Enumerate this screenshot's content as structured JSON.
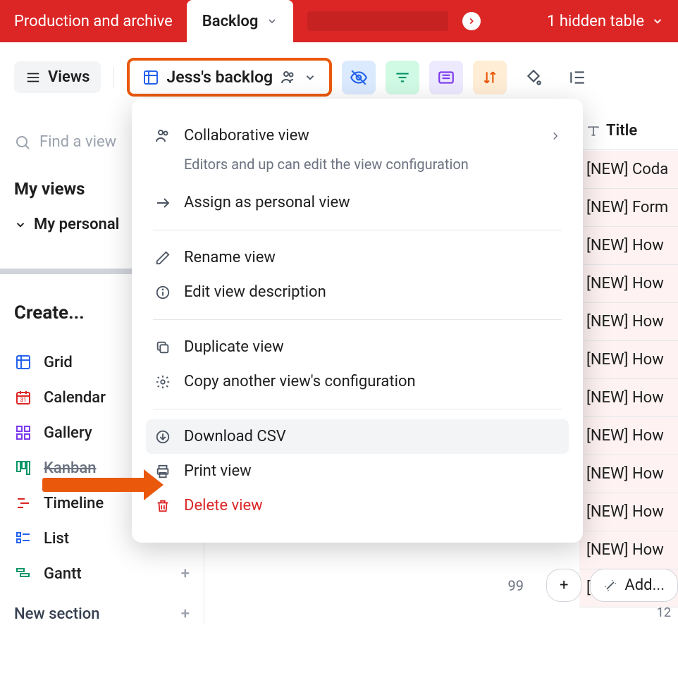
{
  "topbar": {
    "left_label": "Production and archive",
    "active_tab": "Backlog",
    "hidden_label": "1 hidden table"
  },
  "toolbar": {
    "views_label": "Views",
    "current_view": "Jess's backlog"
  },
  "search_placeholder": "Find a view",
  "my_views_label": "My views",
  "personal_label": "My personal",
  "create_label": "Create...",
  "create_items": {
    "grid": "Grid",
    "calendar": "Calendar",
    "gallery": "Gallery",
    "kanban": "Kanban",
    "timeline": "Timeline",
    "list": "List",
    "gantt": "Gantt"
  },
  "new_section": "New section",
  "dropdown": {
    "collaborative": "Collaborative view",
    "collaborative_sub": "Editors and up can edit the view configuration",
    "assign_personal": "Assign as personal view",
    "rename": "Rename view",
    "edit_desc": "Edit view description",
    "duplicate": "Duplicate view",
    "copy_config": "Copy another view's configuration",
    "download_csv": "Download CSV",
    "print": "Print view",
    "delete": "Delete view"
  },
  "table": {
    "title_col": "Title",
    "rows": [
      "[NEW] Coda",
      "[NEW] Form",
      "[NEW] How ",
      "[NEW] How ",
      "[NEW] How ",
      "[NEW] How ",
      "[NEW] How ",
      "[NEW] How ",
      "[NEW] How ",
      "[NEW] How ",
      "[NEW] How ",
      "[NEW] How "
    ],
    "row_num": "99",
    "add_label": "Add...",
    "count": "12"
  }
}
